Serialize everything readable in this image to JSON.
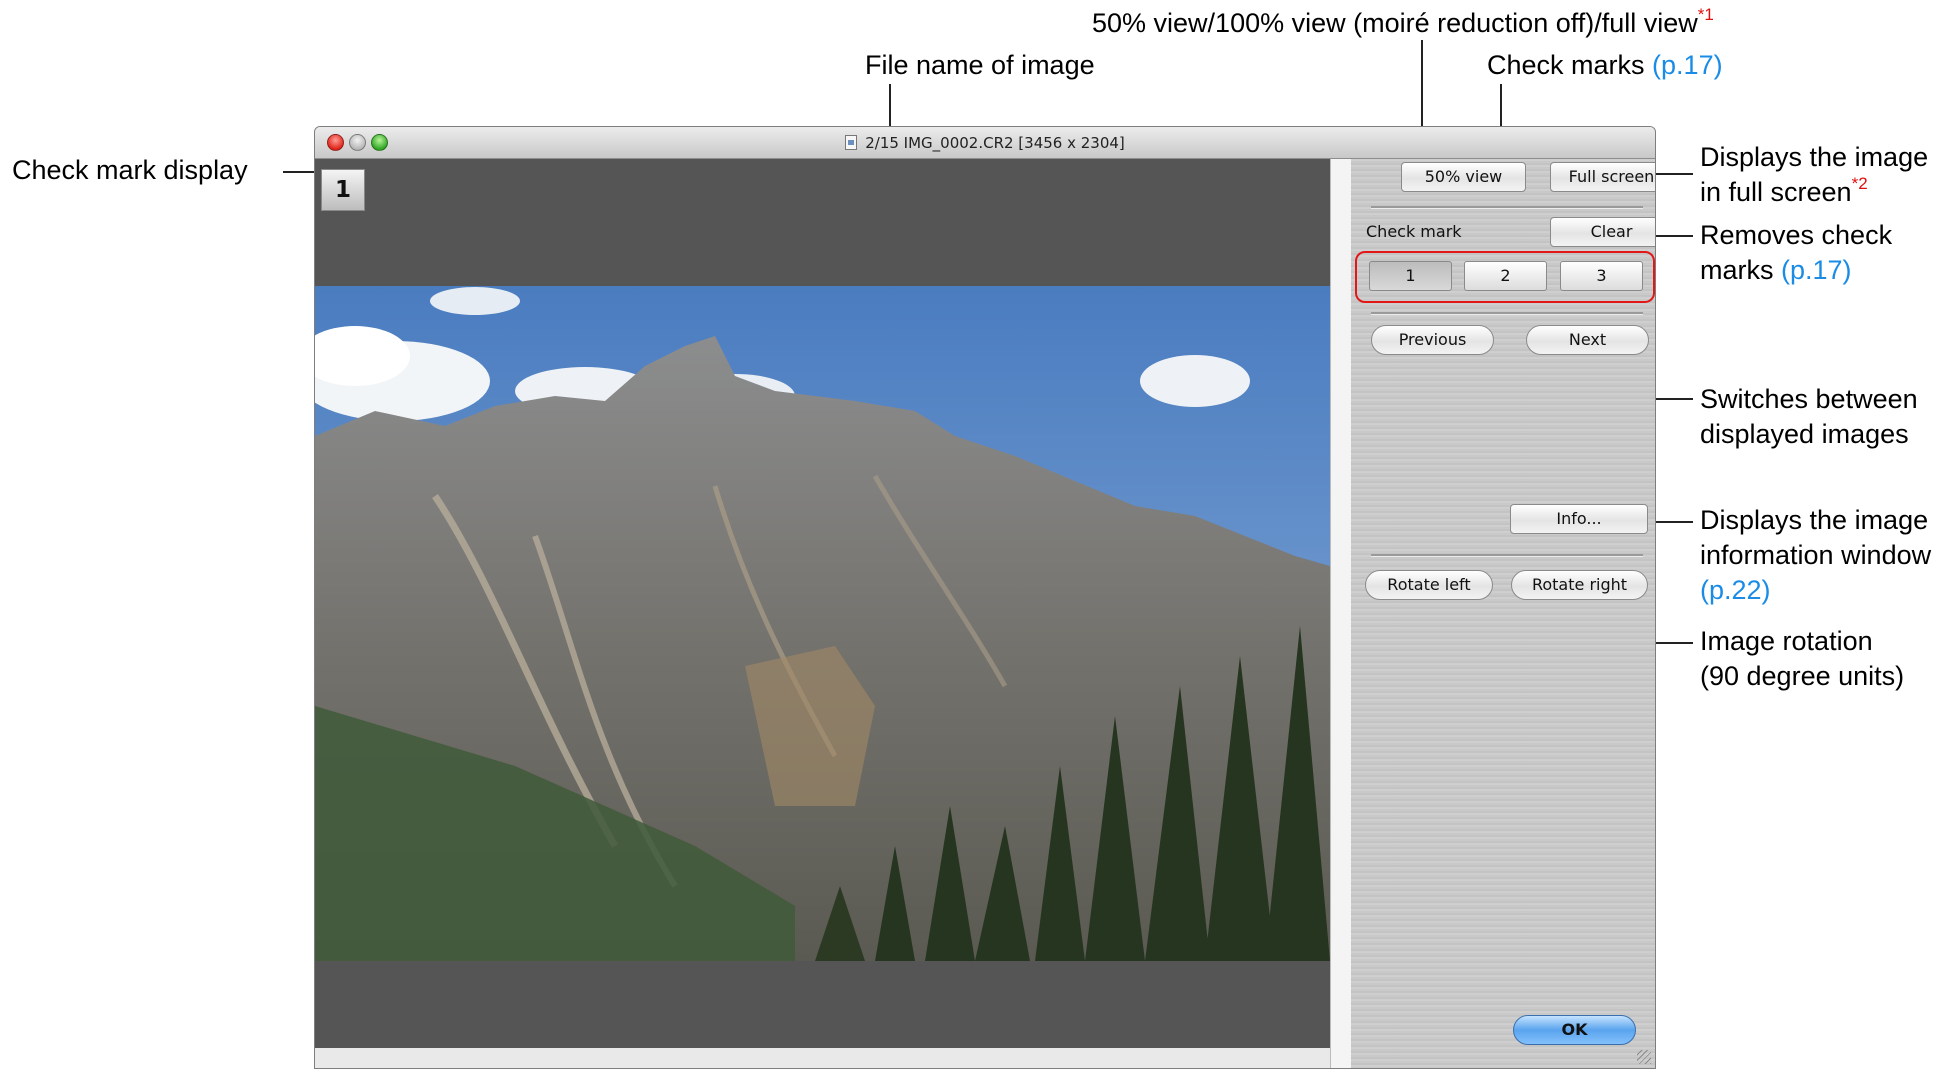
{
  "callouts": {
    "top_line_text": "50% view/100% view (moiré reduction off)/full view",
    "top_line_note": "*1",
    "file_name": "File name of image",
    "check_marks_text": "Check marks",
    "check_marks_ref": "(p.17)",
    "check_mark_display": "Check mark display",
    "full_screen_1": "Displays the image",
    "full_screen_2": "in full screen",
    "full_screen_note": "*2",
    "removes_1": "Removes check",
    "removes_2": "marks",
    "removes_ref": "(p.17)",
    "switches_1": "Switches between",
    "switches_2": "displayed images",
    "info_1": "Displays the image",
    "info_2": "information window",
    "info_ref": "(p.22)",
    "rotation_1": "Image rotation",
    "rotation_2": "(90 degree units)"
  },
  "window": {
    "title": "2/15 IMG_0002.CR2 [3456 x 2304]",
    "check_badge": "1"
  },
  "panel": {
    "view_button": "50%  view",
    "full_screen_button": "Full screen",
    "check_mark_label": "Check mark",
    "clear_button": "Clear",
    "check_1": "1",
    "check_2": "2",
    "check_3": "3",
    "previous_button": "Previous",
    "next_button": "Next",
    "info_button": "Info...",
    "rotate_left_button": "Rotate left",
    "rotate_right_button": "Rotate right",
    "ok_button": "OK"
  },
  "colors": {
    "reference_link": "#1a8ce6",
    "footnote": "#e01010",
    "highlight_box": "#e21818"
  }
}
